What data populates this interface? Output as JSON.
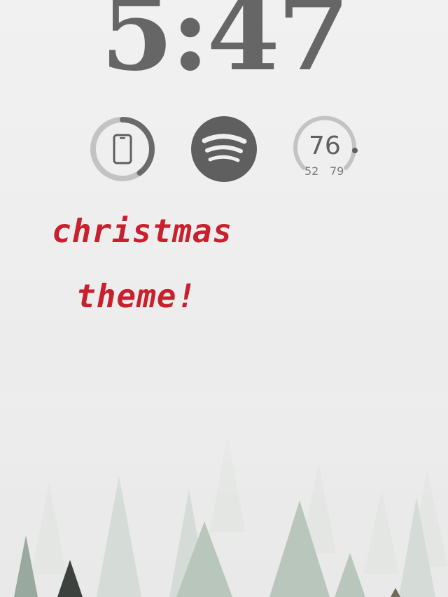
{
  "lockscreen": {
    "time": "5:47",
    "widgets": {
      "battery": {
        "icon": "phone-icon",
        "level": 0.4
      },
      "spotify": {
        "icon": "spotify-icon"
      },
      "weather": {
        "current": "76",
        "low": "52",
        "high": "79"
      }
    },
    "caption": {
      "line1": "christmas",
      "line2": "theme!"
    }
  },
  "colors": {
    "clock": "#666666",
    "caption": "#c9202e",
    "widget": "#5f5f5f"
  }
}
